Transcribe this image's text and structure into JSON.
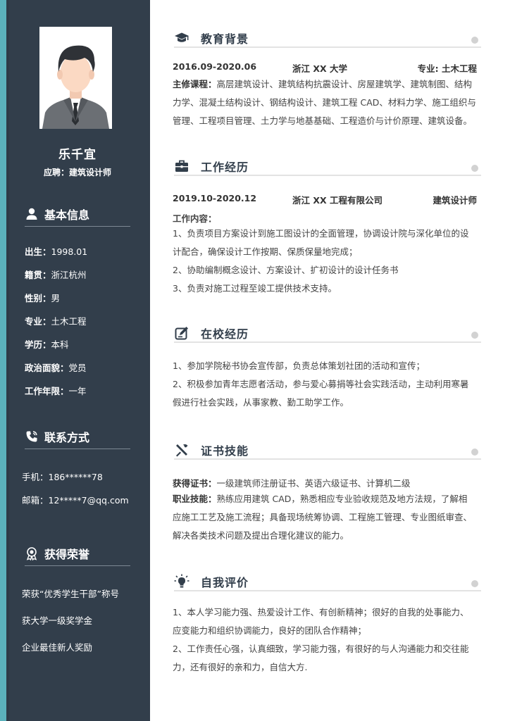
{
  "profile": {
    "name": "乐千宜",
    "apply_label": "应聘：",
    "apply_value": "建筑设计师"
  },
  "basic_info": {
    "title": "基本信息",
    "items": [
      {
        "label": "出生：",
        "value": "1998.01"
      },
      {
        "label": "籍贯：",
        "value": "浙江杭州"
      },
      {
        "label": "性别：",
        "value": "男"
      },
      {
        "label": "专业：",
        "value": "土木工程"
      },
      {
        "label": "学历：",
        "value": "本科"
      },
      {
        "label": "政治面貌：",
        "value": "党员"
      },
      {
        "label": "工作年限：",
        "value": "一年"
      }
    ]
  },
  "contact": {
    "title": "联系方式",
    "items": [
      {
        "label": "手机：",
        "value": "186******78"
      },
      {
        "label": "邮箱：",
        "value": "12*****7@qq.com"
      }
    ]
  },
  "honors": {
    "title": "获得荣誉",
    "items": [
      "荣获“优秀学生干部”称号",
      "获大学一级奖学金",
      "企业最佳新人奖励"
    ]
  },
  "education": {
    "title": "教育背景",
    "period": "2016.09-2020.06",
    "school": "浙江 XX 大学",
    "major": "专业: 土木工程",
    "courses_label": "主修课程：",
    "courses_lines": [
      "高层建筑设计、建筑结构抗震设计、房屋建筑学、建筑制图、结构",
      "力学、混凝土结构设计、钢结构设计、建筑工程 CAD、材料力学、施工组织与",
      "管理、工程项目管理、土力学与地基基础、工程造价与计价原理、建筑设备。"
    ]
  },
  "work": {
    "title": "工作经历",
    "period": "2019.10-2020.12",
    "company": "浙江 XX 工程有限公司",
    "position": "建筑设计师",
    "content_label": "工作内容：",
    "lines": [
      "1、负责项目方案设计到施工图设计的全面管理，协调设计院与深化单位的设",
      "计配合，确保设计工作按期、保质保量地完成；",
      "2、协助编制概念设计、方案设计、扩初设计的设计任务书",
      "3、负责对施工过程至竣工提供技术支持。"
    ]
  },
  "campus": {
    "title": "在校经历",
    "lines": [
      "1、参加学院秘书协会宣传部，负责总体策划社团的活动和宣传；",
      "2、积极参加青年志愿者活动，参与爱心募捐等社会实践活动，主动利用寒暑",
      "假进行社会实践，从事家教、勤工助学工作。"
    ]
  },
  "skills": {
    "title": "证书技能",
    "cert_label": "获得证书：",
    "cert_value": "一级建筑师注册证书、英语六级证书、计算机二级",
    "skill_label": "职业技能：",
    "skill_lines": [
      "熟练应用建筑 CAD，熟悉相应专业验收规范及地方法规，了解相",
      "应施工工艺及施工流程；具备现场统筹协调、工程施工管理、专业图纸审查、",
      "解决各类技术问题及提出合理化建议的能力。"
    ]
  },
  "self_eval": {
    "title": "自我评价",
    "lines": [
      "1、本人学习能力强、热爱设计工作、有创新精神；很好的自我的处事能力、",
      "应变能力和组织协调能力，良好的团队合作精神；",
      "2、工作责任心强，认真细致，学习能力强，有很好的与人沟通能力和交往能",
      "力，还有很好的亲和力，自信大方."
    ]
  },
  "colors": {
    "sidebar": "#323e4b",
    "accent": "#5bb1bb",
    "divider": "#e3e3e3"
  },
  "icons": {
    "basic_info": "user-icon",
    "contact": "phone-icon",
    "honors": "medal-icon",
    "education": "graduation-cap-icon",
    "work": "briefcase-icon",
    "campus": "edit-icon",
    "skills": "tools-icon",
    "self_eval": "lightbulb-icon"
  }
}
